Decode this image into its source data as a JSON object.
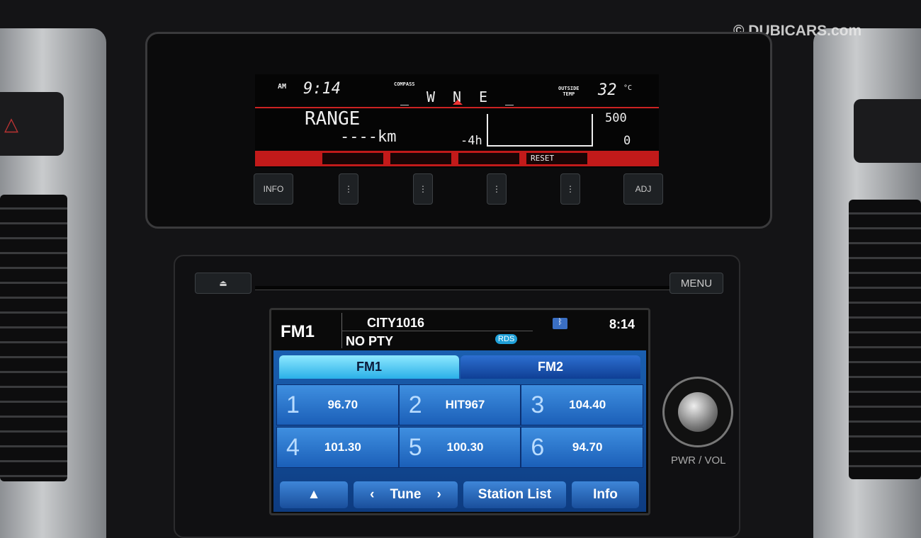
{
  "watermark": "© DUBICARS.com",
  "lcd": {
    "am_label": "AM",
    "clock": "9:14",
    "compass_label": "COMPASS",
    "compass": [
      "_",
      "W",
      "N",
      "E",
      "_"
    ],
    "outside_temp_label": [
      "OUTSIDE",
      "TEMP"
    ],
    "temp": "32",
    "temp_unit": "°C",
    "range_label": "RANGE",
    "range_value": "----km",
    "graph_x_label": "-4h",
    "graph_y_max": "500",
    "graph_y_min": "0",
    "softkeys": [
      "",
      "",
      "",
      "RESET"
    ]
  },
  "hardware": {
    "info": "INFO",
    "adj": "ADJ",
    "eject_icon": "eject",
    "menu": "MENU",
    "pwr_vol": "PWR / VOL"
  },
  "radio": {
    "band": "FM1",
    "station": "CITY1016",
    "pty": "NO PTY",
    "rds": "RDS",
    "clock": "8:14",
    "bluetooth_icon": "bluetooth-phone",
    "tabs": [
      {
        "label": "FM1",
        "active": true
      },
      {
        "label": "FM2",
        "active": false
      }
    ],
    "presets": [
      {
        "num": "1",
        "freq": "96.70"
      },
      {
        "num": "2",
        "freq": "HIT967"
      },
      {
        "num": "3",
        "freq": "104.40"
      },
      {
        "num": "4",
        "freq": "101.30"
      },
      {
        "num": "5",
        "freq": "100.30"
      },
      {
        "num": "6",
        "freq": "94.70"
      }
    ],
    "buttons": {
      "up": "▲",
      "tune": "Tune",
      "tune_prev": "‹",
      "tune_next": "›",
      "station_list": "Station List",
      "info": "Info"
    }
  }
}
